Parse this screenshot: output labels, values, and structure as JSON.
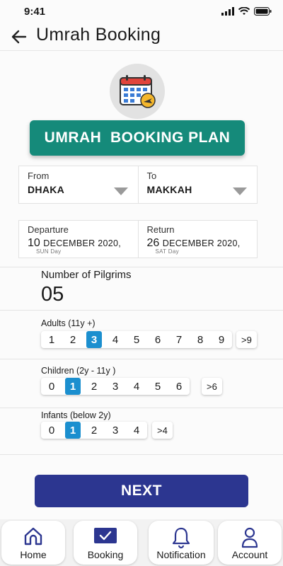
{
  "status_bar": {
    "time": "9:41"
  },
  "header": {
    "title": "Umrah Booking"
  },
  "banner": {
    "label": "UMRAH  BOOKING PLAN"
  },
  "route": {
    "from_label": "From",
    "from_value": "DHAKA",
    "to_label": "To",
    "to_value": "MAKKAH"
  },
  "dates": {
    "departure_label": "Departure",
    "departure_day": "10",
    "departure_month": "DECEMBER 2020,",
    "departure_weekday": "SUN Day",
    "return_label": "Return",
    "return_day": "26",
    "return_month": "DECEMBER 2020,",
    "return_weekday": "SAT Day"
  },
  "pilgrims": {
    "label": "Number of Pilgrims",
    "count": "05"
  },
  "adults": {
    "label": "Adults (11y +)",
    "options": [
      "1",
      "2",
      "3",
      "4",
      "5",
      "6",
      "7",
      "8",
      "9"
    ],
    "selected": "3",
    "more": ">9"
  },
  "children": {
    "label": "Children (2y - 11y )",
    "options": [
      "0",
      "1",
      "2",
      "3",
      "4",
      "5",
      "6"
    ],
    "selected": "1",
    "more": ">6"
  },
  "infants": {
    "label": "Infants (below 2y)",
    "options": [
      "0",
      "1",
      "2",
      "3",
      "4"
    ],
    "selected": "1",
    "more": ">4"
  },
  "next_button": {
    "label": "NEXT"
  },
  "nav": {
    "items": [
      {
        "label": "Home",
        "icon": "home-icon"
      },
      {
        "label": "Booking",
        "icon": "booking-check-icon"
      },
      {
        "label": "Notification",
        "icon": "bell-icon"
      },
      {
        "label": "Account",
        "icon": "user-icon"
      }
    ]
  },
  "colors": {
    "banner": "#158a7a",
    "selected": "#1b8fcf",
    "next_button": "#2c3690",
    "nav_icon": "#2c3690"
  }
}
